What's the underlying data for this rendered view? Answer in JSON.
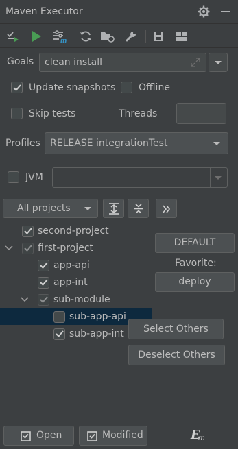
{
  "window": {
    "title": "Maven Executor"
  },
  "goals": {
    "label": "Goals",
    "value": "clean install"
  },
  "options": {
    "update_snapshots": {
      "label": "Update snapshots",
      "checked": true
    },
    "offline": {
      "label": "Offline",
      "checked": false
    },
    "skip_tests": {
      "label": "Skip tests",
      "checked": false
    },
    "threads_label": "Threads",
    "threads_value": ""
  },
  "profiles": {
    "label": "Profiles",
    "value": "RELEASE  integrationTest"
  },
  "jvm": {
    "label": "JVM",
    "checked": false,
    "value": ""
  },
  "projects_filter": {
    "value": "All projects"
  },
  "tree": [
    {
      "label": "second-project",
      "checked": true,
      "level": 0,
      "expandable": false,
      "dim": false
    },
    {
      "label": "first-project",
      "checked": true,
      "level": 0,
      "expandable": true,
      "dim": true
    },
    {
      "label": "app-api",
      "checked": true,
      "level": 1,
      "expandable": false,
      "dim": false
    },
    {
      "label": "app-int",
      "checked": true,
      "level": 1,
      "expandable": false,
      "dim": false
    },
    {
      "label": "sub-module",
      "checked": true,
      "level": 1,
      "expandable": true,
      "dim": true
    },
    {
      "label": "sub-app-api",
      "checked": false,
      "level": 2,
      "expandable": false,
      "dim": false
    },
    {
      "label": "sub-app-int",
      "checked": true,
      "level": 2,
      "expandable": false,
      "dim": false
    }
  ],
  "right_panel": {
    "default_button": "DEFAULT",
    "favorite_label": "Favorite:",
    "deploy_button": "deploy"
  },
  "context_menu": {
    "select_others": "Select Others",
    "deselect_others": "Deselect Others"
  },
  "bottom": {
    "open_button": "Open",
    "modified_button": "Modified",
    "logo_text": "E"
  },
  "colors": {
    "background": "#3c3f41",
    "field": "#45494a",
    "selection": "#0d293e",
    "run_green": "#499c54",
    "accent_blue": "#3592c4"
  }
}
